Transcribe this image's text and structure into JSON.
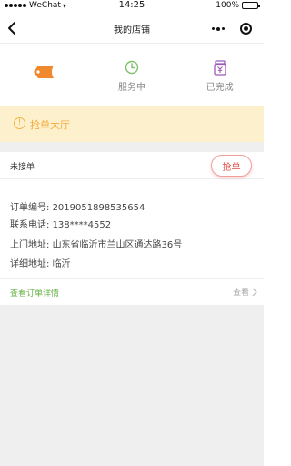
{
  "status_bar": {
    "carrier": "WeChat",
    "time": "14:25",
    "battery": "100%",
    "battery_level": 1.0
  },
  "nav": {
    "title": "我的店铺"
  },
  "tabs": [
    {
      "label": "",
      "icon": "tag-icon",
      "color": "#f0892e"
    },
    {
      "label": "服务中",
      "icon": "clock-icon",
      "color": "#7cc26b"
    },
    {
      "label": "已完成",
      "icon": "yen-jar-icon",
      "color": "#9b59b6"
    }
  ],
  "banner": {
    "text": "抢单大厅",
    "color": "#f3a93a",
    "background": "#fdf1cd"
  },
  "order": {
    "status": "未接单",
    "grab_label": "抢单",
    "rows": [
      {
        "key": "订单编号:",
        "value": "2019051898535654"
      },
      {
        "key": "联系电话:",
        "value": "138****4552"
      },
      {
        "key": "上门地址:",
        "value": "山东省临沂市兰山区通达路36号"
      },
      {
        "key": "详细地址:",
        "value": "临沂"
      }
    ],
    "detail_link": "查看订单详情",
    "view_label": "查看"
  },
  "colors": {
    "accent_red": "#e24c46",
    "link_green": "#6ab24a"
  }
}
